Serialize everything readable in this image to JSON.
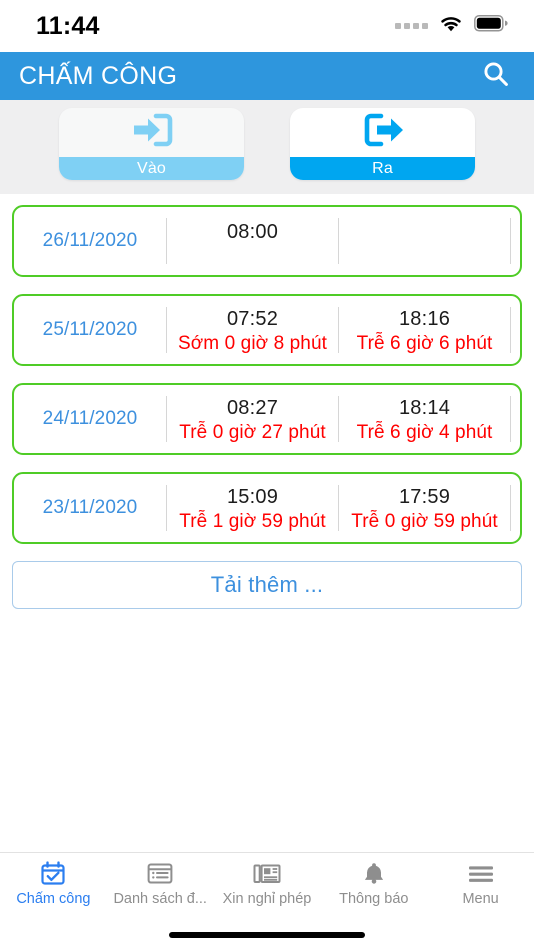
{
  "status_bar": {
    "time": "11:44",
    "signal_icon": "signal-dots-icon",
    "wifi_icon": "wifi-icon",
    "battery_icon": "battery-full-icon"
  },
  "header": {
    "title": "CHẤM CÔNG",
    "search_icon": "search-icon",
    "background_color": "#2e96dd"
  },
  "mode_toggle": {
    "buttons": [
      {
        "label": "Vào",
        "icon": "sign-in-icon",
        "state": "inactive",
        "accent_color": "#7fd0f4"
      },
      {
        "label": "Ra",
        "icon": "sign-out-icon",
        "state": "active",
        "accent_color": "#00a6f0"
      }
    ]
  },
  "records": [
    {
      "date": "26/11/2020",
      "check_in": {
        "time": "08:00",
        "note": ""
      },
      "check_out": {
        "time": "",
        "note": ""
      }
    },
    {
      "date": "25/11/2020",
      "check_in": {
        "time": "07:52",
        "note": "Sớm 0 giờ 8 phút"
      },
      "check_out": {
        "time": "18:16",
        "note": "Trễ 6 giờ 6 phút"
      }
    },
    {
      "date": "24/11/2020",
      "check_in": {
        "time": "08:27",
        "note": "Trễ 0 giờ 27 phút"
      },
      "check_out": {
        "time": "18:14",
        "note": "Trễ 6 giờ 4 phút"
      }
    },
    {
      "date": "23/11/2020",
      "check_in": {
        "time": "15:09",
        "note": "Trễ 1 giờ 59 phút"
      },
      "check_out": {
        "time": "17:59",
        "note": "Trễ 0 giờ 59 phút"
      }
    }
  ],
  "load_more": {
    "label": "Tải thêm ..."
  },
  "tab_bar": {
    "items": [
      {
        "label": "Chấm công",
        "icon": "calendar-check-icon",
        "selected": true
      },
      {
        "label": "Danh sách đ...",
        "icon": "list-icon",
        "selected": false
      },
      {
        "label": "Xin nghỉ phép",
        "icon": "newspaper-icon",
        "selected": false
      },
      {
        "label": "Thông báo",
        "icon": "bell-icon",
        "selected": false
      },
      {
        "label": "Menu",
        "icon": "hamburger-menu-icon",
        "selected": false
      }
    ]
  },
  "colors": {
    "card_border_green": "#4fcc26",
    "date_blue": "#3d90de",
    "note_red": "#ff0000",
    "header_blue": "#2e96dd",
    "tab_active_blue": "#2b7ef0",
    "strip_grey": "#efeff0"
  }
}
